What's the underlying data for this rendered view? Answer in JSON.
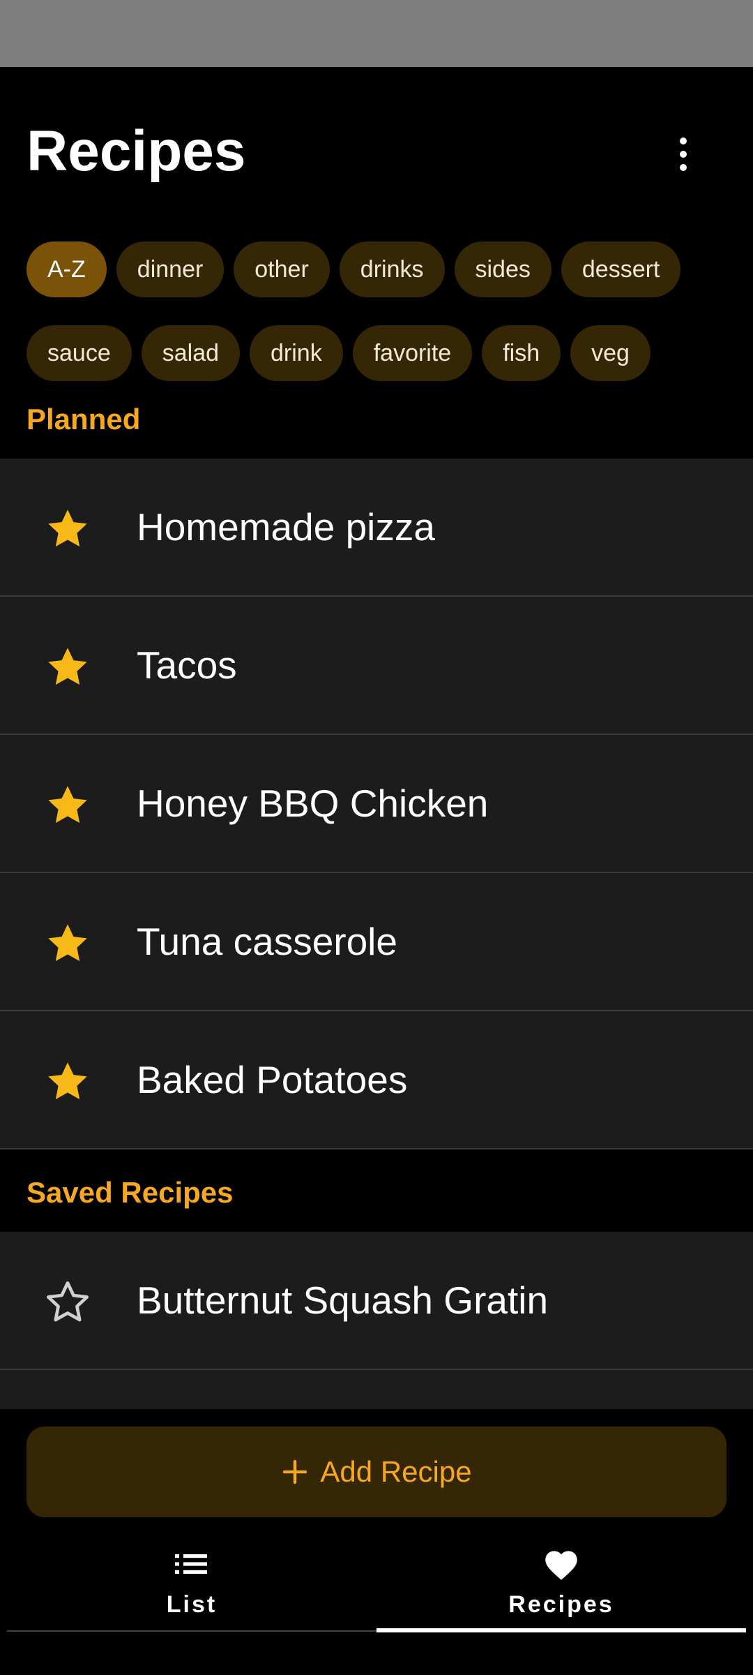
{
  "header": {
    "title": "Recipes"
  },
  "filters": {
    "row1": [
      "A-Z",
      "dinner",
      "other",
      "drinks",
      "sides",
      "dessert"
    ],
    "row2": [
      "sauce",
      "salad",
      "drink",
      "favorite",
      "fish",
      "veg"
    ],
    "selected": "A-Z"
  },
  "planned": {
    "label": "Planned",
    "items": [
      {
        "title": "Homemade pizza",
        "starred": true
      },
      {
        "title": "Tacos",
        "starred": true
      },
      {
        "title": "Honey BBQ Chicken",
        "starred": true
      },
      {
        "title": "Tuna casserole",
        "starred": true
      },
      {
        "title": "Baked Potatoes",
        "starred": true
      }
    ]
  },
  "saved": {
    "label": "Saved Recipes",
    "items": [
      {
        "title": "Butternut Squash Gratin",
        "starred": false
      }
    ]
  },
  "add_button": {
    "label": "Add Recipe"
  },
  "bottom_nav": {
    "list": {
      "label": "List",
      "icon": "list-icon"
    },
    "recipes": {
      "label": "Recipes",
      "icon": "heart-icon",
      "active": true
    }
  },
  "colors": {
    "accent": "#f6a820",
    "star": "#f7b917",
    "chip_bg": "#352605",
    "chip_selected_bg": "#7a5308",
    "row_bg": "#1c1c1c"
  }
}
